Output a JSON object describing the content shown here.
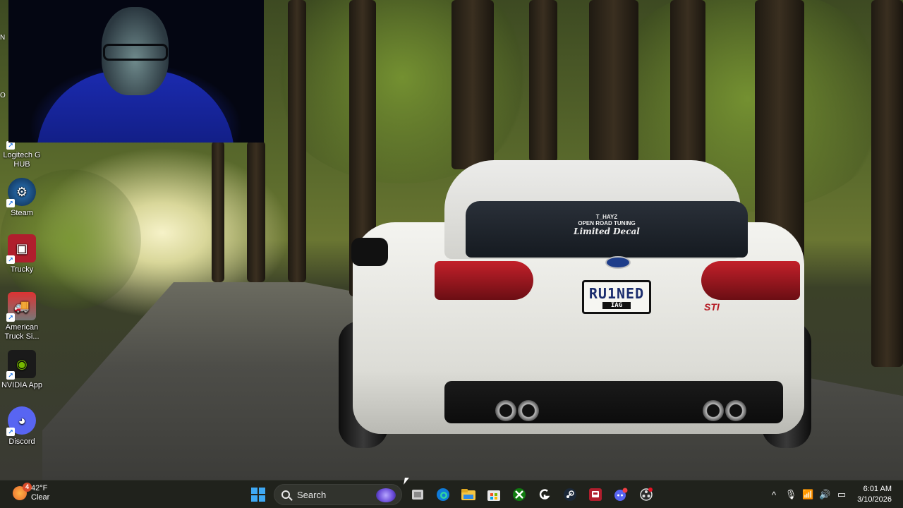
{
  "desktop": {
    "icons": [
      {
        "label": "Logitech G HUB",
        "icon": "logitech-g-icon"
      },
      {
        "label": "Steam",
        "icon": "steam-icon"
      },
      {
        "label": "Trucky",
        "icon": "trucky-icon"
      },
      {
        "label": "American Truck Si...",
        "icon": "truck-icon"
      },
      {
        "label": "NVIDIA App",
        "icon": "nvidia-icon"
      },
      {
        "label": "Discord",
        "icon": "discord-icon"
      }
    ],
    "clipped_letters": [
      "N",
      "O"
    ]
  },
  "wallpaper": {
    "plate_main": "RU1NED",
    "plate_sub": "IAG",
    "decal_line1": "T_HAYZ",
    "decal_line2": "OPEN ROAD TUNING",
    "decal_line3": "Limited Decal",
    "badge": "STI"
  },
  "taskbar": {
    "weather": {
      "temp": "42°F",
      "condition": "Clear",
      "badge": "4"
    },
    "search_placeholder": "Search",
    "apps": [
      "task-view-icon",
      "edge-icon",
      "file-explorer-icon",
      "microsoft-store-icon",
      "xbox-icon",
      "logitech-g-icon",
      "steam-icon",
      "trucky-icon",
      "discord-icon",
      "obs-icon"
    ],
    "tray": {
      "chevron": "^",
      "mic": "🎙",
      "wifi": "📶",
      "volume": "🔊",
      "battery": "▭"
    },
    "clock": {
      "time": "6:01 AM",
      "date": "3/10/2026"
    }
  },
  "colors": {
    "taskbar_bg": "#20221c",
    "windows_blue": "#1e90ff",
    "discord": "#5865f2",
    "steam": "#1b2838",
    "nvidia": "#76b900",
    "trucky": "#b01e2d"
  }
}
